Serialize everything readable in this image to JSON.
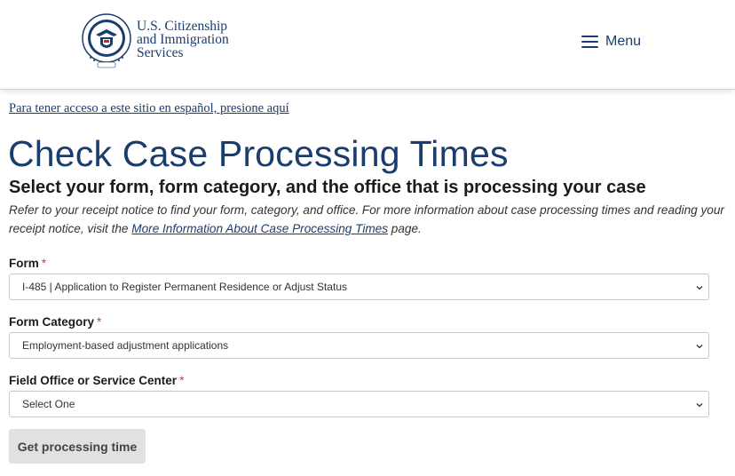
{
  "header": {
    "logo_lines": [
      "U.S. Citizenship",
      "and Immigration",
      "Services"
    ],
    "seal_icon": "dhs-seal-icon",
    "menu_label": "Menu",
    "menu_icon": "hamburger-icon"
  },
  "spanish_link": "Para tener acceso a este sitio en español, presione aquí",
  "title": "Check Case Processing Times",
  "subtitle": "Select your form, form category, and the office that is processing your case",
  "intro": {
    "before": "Refer to your receipt notice to find your form, category, and office. For more information about case processing times and reading your receipt notice, visit the ",
    "link": "More Information About Case Processing Times",
    "after": " page."
  },
  "form": {
    "form_label": "Form",
    "form_value": "I-485 | Application to Register Permanent Residence or Adjust Status",
    "category_label": "Form Category",
    "category_value": "Employment-based adjustment applications",
    "office_label": "Field Office or Service Center",
    "office_value": "Select One",
    "required_mark": "*",
    "submit_label": "Get processing time"
  },
  "colors": {
    "brand": "#1a3d6d",
    "required": "#d83933",
    "button_bg": "#dfe1e2"
  }
}
